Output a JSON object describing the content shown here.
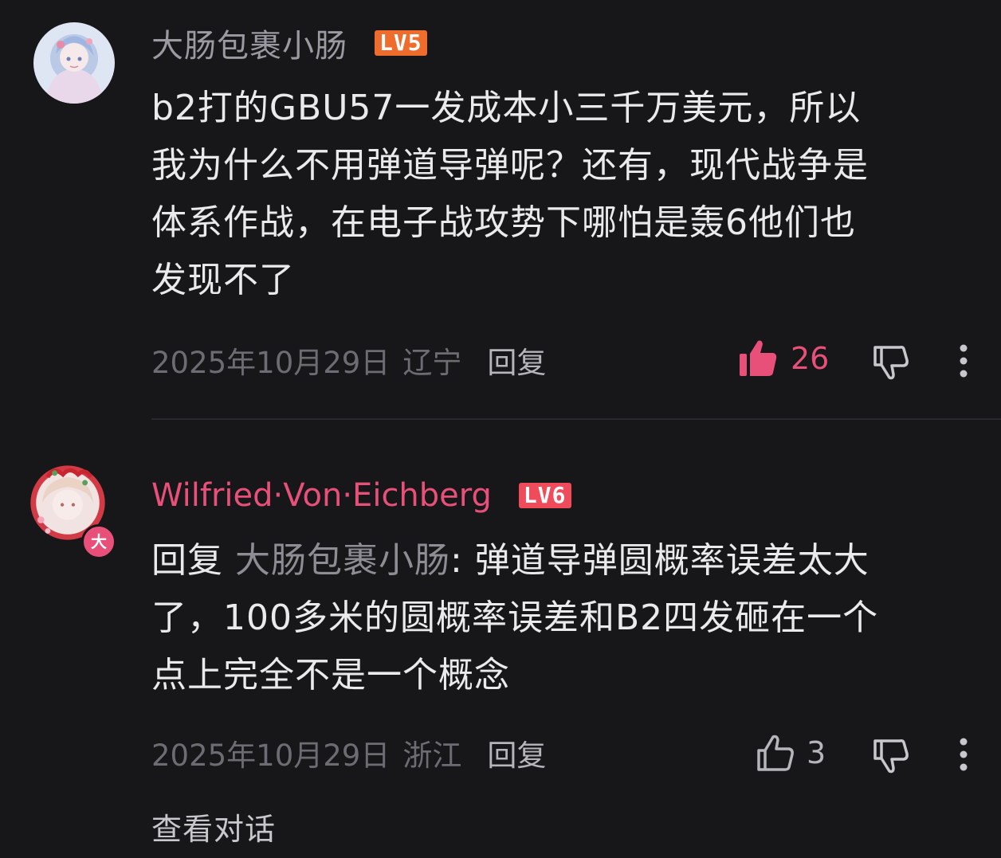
{
  "comments": [
    {
      "username": "大肠包裹小肠",
      "level": "LV5",
      "text_lines": [
        "b2打的GBU57一发成本小三千万美元，所以",
        "我为什么不用弹道导弹呢？还有，现代战争是",
        "体系作战，在电子战攻势下哪怕是轰6他们也",
        "发现不了"
      ],
      "time": "2025年10月29日",
      "location": "辽宁",
      "reply_label": "回复",
      "likes": "26",
      "liked": true,
      "colors": {
        "username": "#9a9aa0",
        "badge": "#ee6c2c",
        "like": "#e8507a"
      }
    },
    {
      "username": "Wilfried·Von·Eichberg",
      "level": "LV6",
      "avatar_badge": "大",
      "reply_prefix": "回复",
      "mention": "大肠包裹小肠",
      "text_first": ": 弹道导弹圆概率误差太大",
      "text_lines": [
        "了，100多米的圆概率误差和B2四发砸在一个",
        "点上完全不是一个概念"
      ],
      "time": "2025年10月29日",
      "location": "浙江",
      "reply_label": "回复",
      "likes": "3",
      "liked": false,
      "colors": {
        "username": "#e8507a",
        "badge": "#f04b5b",
        "like": "#b5b5ba"
      }
    }
  ],
  "footer": {
    "view_thread": "查看对话"
  },
  "icons": [
    "thumbs-up-filled-icon",
    "thumbs-down-icon",
    "more-vertical-icon",
    "thumbs-up-outline-icon"
  ]
}
